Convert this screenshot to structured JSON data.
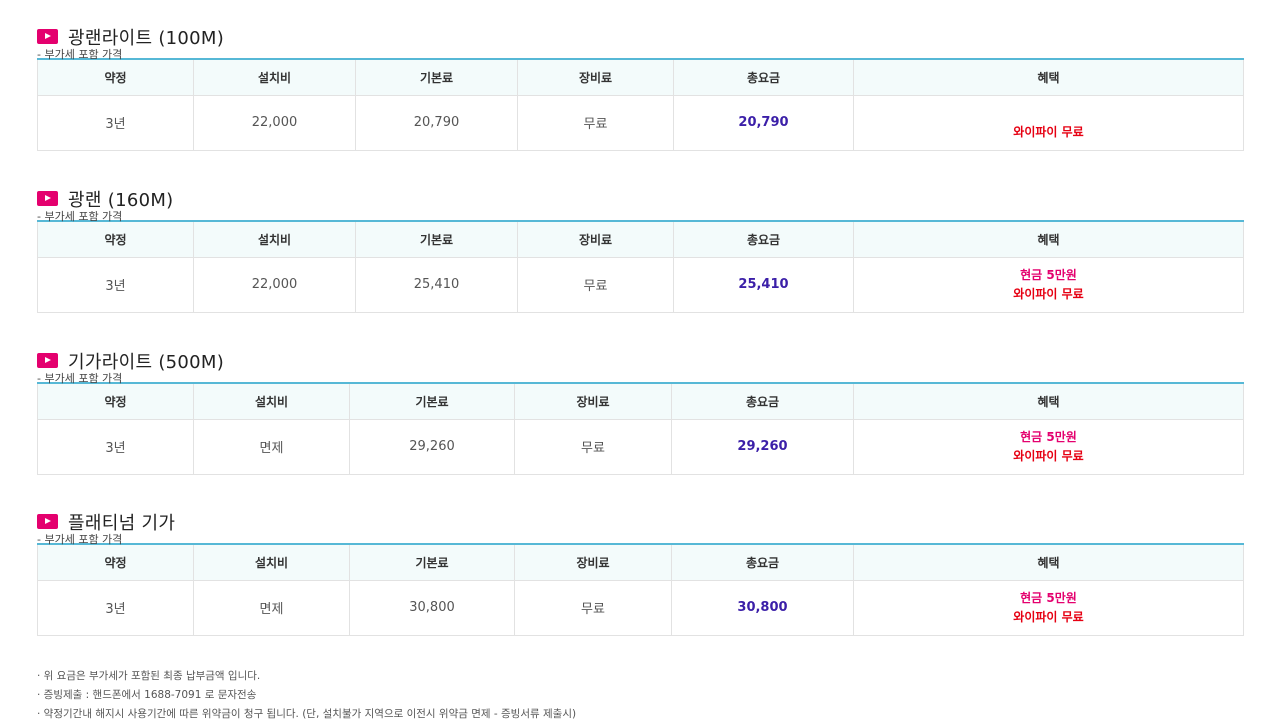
{
  "headers": [
    "약정",
    "설치비",
    "기본료",
    "장비료",
    "총요금",
    "혜택"
  ],
  "sub": "- 부가세 포함 가격",
  "plans": [
    {
      "title": "광랜라이트 (100M)",
      "contract": "3년",
      "install": "22,000",
      "base": "20,790",
      "equip": "무료",
      "total": "20,790",
      "cash": "",
      "wifi": "와이파이 무료"
    },
    {
      "title": "광랜 (160M)",
      "contract": "3년",
      "install": "22,000",
      "base": "25,410",
      "equip": "무료",
      "total": "25,410",
      "cash": "현금 5만원",
      "wifi": "와이파이 무료"
    },
    {
      "title": "기가라이트 (500M)",
      "contract": "3년",
      "install": "면제",
      "base": "29,260",
      "equip": "무료",
      "total": "29,260",
      "cash": "현금 5만원",
      "wifi": "와이파이 무료"
    },
    {
      "title": "플래티넘 기가",
      "contract": "3년",
      "install": "면제",
      "base": "30,800",
      "equip": "무료",
      "total": "30,800",
      "cash": "현금 5만원",
      "wifi": "와이파이 무료"
    }
  ],
  "notes": [
    "· 위 요금은 부가세가 포함된 최종 납부금액 입니다.",
    "· 증빙제출 : 핸드폰에서 1688-7091 로 문자전송",
    "· 약정기간내 해지시 사용기간에 따른 위약금이 청구 됩니다. (단, 설치불가 지역으로 이전시 위약금 면제 - 증빙서류 제출시)"
  ],
  "colors": {
    "accent": "#e4006e",
    "header_border": "#56b8d6",
    "total": "#3b1fa8",
    "benefit": "#e60012"
  }
}
